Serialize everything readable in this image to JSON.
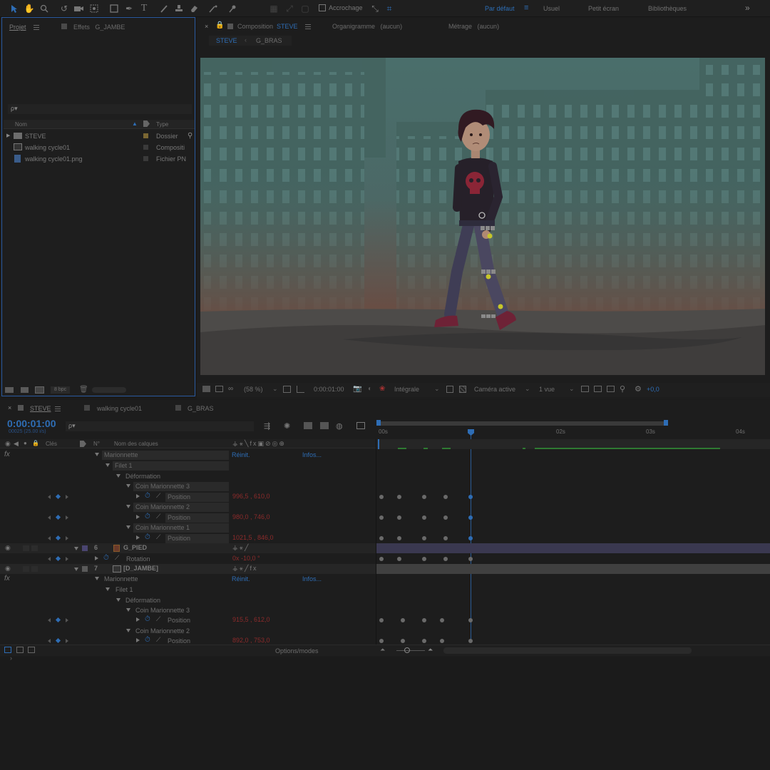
{
  "toolbar": {
    "snapping_label": "Accrochage",
    "workspaces": [
      "Par défaut",
      "Usuel",
      "Petit écran",
      "Bibliothèques"
    ],
    "active_workspace": "Par défaut",
    "more_label": "»"
  },
  "project_panel": {
    "tab_project": "Projet",
    "tab_effects": "Effets",
    "effects_target": "G_JAMBE",
    "search_placeholder": "ρ▾",
    "col_name": "Nom",
    "col_type": "Type",
    "items": [
      {
        "name": "STEVE",
        "type": "Dossier",
        "icon": "folder-icon",
        "swatch": "#7a6632"
      },
      {
        "name": "walking cycle01",
        "type": "Compositi",
        "icon": "composition-icon",
        "swatch": "#3a3a3a"
      },
      {
        "name": "walking cycle01.png",
        "type": "Fichier PN",
        "icon": "image-file-icon",
        "swatch": "#3a3a3a"
      }
    ],
    "bpc_label": "8 bpc"
  },
  "composition_panel": {
    "tab_prefix": "Composition",
    "comp_name": "STEVE",
    "flowchart_label": "Organigramme",
    "flowchart_value": "(aucun)",
    "footage_label": "Métrage",
    "footage_value": "(aucun)",
    "breadcrumbs": [
      "STEVE",
      "G_BRAS"
    ]
  },
  "viewer_bar": {
    "zoom": "(58 %)",
    "timecode": "0:00:01:00",
    "resolution": "Intégrale",
    "camera": "Caméra active",
    "views": "1 vue",
    "exposure": "+0,0"
  },
  "timeline": {
    "tabs": [
      "STEVE",
      "walking cycle01",
      "G_BRAS"
    ],
    "current_time": "0:00:01:00",
    "frame_info": "00025 (25.00 i/s)",
    "search_placeholder": "ρ▾",
    "col_keys": "Clés",
    "col_num": "N°",
    "col_layer_name": "Nom des calques",
    "ruler_labels": [
      "00s",
      "02s",
      "03s",
      "04s"
    ],
    "fx_label": "fx",
    "rows": [
      {
        "label": "Marionnette",
        "link1": "Réinit.",
        "link2": "Infos..."
      },
      {
        "label": "Filet 1"
      },
      {
        "label": "Déformation"
      },
      {
        "label": "Coin Marionnette 3"
      },
      {
        "label": "Position",
        "value": "996,5 , 610,0"
      },
      {
        "label": "Coin Marionnette 2"
      },
      {
        "label": "Position",
        "value": "980,0 , 746,0"
      },
      {
        "label": "Coin Marionnette 1"
      },
      {
        "label": "Position",
        "value": "1021,5 , 846,0"
      },
      {
        "num": "6",
        "label": "G_PIED"
      },
      {
        "label": "Rotation",
        "value": "0x -10,0 °"
      },
      {
        "num": "7",
        "label": "[D_JAMBE]"
      },
      {
        "label": "Marionnette",
        "link1": "Réinit.",
        "link2": "Infos..."
      },
      {
        "label": "Filet 1"
      },
      {
        "label": "Déformation"
      },
      {
        "label": "Coin Marionnette 3"
      },
      {
        "label": "Position",
        "value": "915,5 , 612,0"
      },
      {
        "label": "Coin Marionnette 2"
      },
      {
        "label": "Position",
        "value": "892,0 , 753,0"
      }
    ],
    "options_label": "Options/modes"
  },
  "colors": {
    "accent": "#2e6db5",
    "value_red": "#8c2b2b",
    "label_purple": "#4a4570",
    "label_gray": "#5a5a5a"
  }
}
